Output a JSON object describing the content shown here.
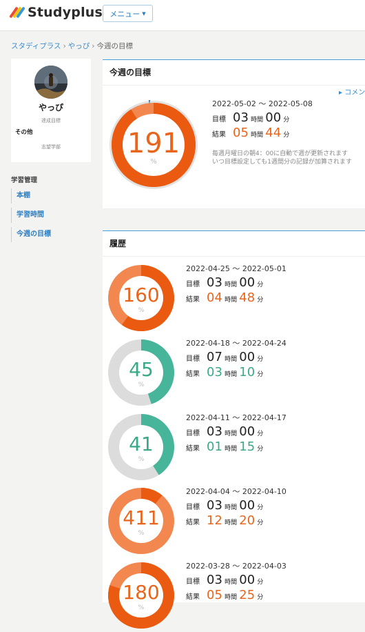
{
  "header": {
    "brand": "Studyplus",
    "menu_label": "メニュー"
  },
  "breadcrumb": {
    "items": [
      "スタディプラス",
      "やっぴ"
    ],
    "current": "今週の目標"
  },
  "profile": {
    "name": "やっぴ",
    "goal_label": "達成目標",
    "other_label": "その他",
    "aspiration_label": "志望学部"
  },
  "nav": {
    "title": "学習管理",
    "items": [
      "本棚",
      "学習時間",
      "今週の目標"
    ]
  },
  "current": {
    "title": "今週の目標",
    "comment_link": "コメン",
    "range": "2022-05-02 ～ 2022-05-08",
    "percent": "191",
    "goal_label": "目標",
    "goal_h": "03",
    "goal_m": "00",
    "result_label": "結果",
    "result_h": "05",
    "result_m": "44",
    "note1": "毎週月曜日の朝4：00に自動で週が更新されます",
    "note2": "いつ目標設定しても1週間分の記録が加算されます",
    "ratio": 1.91
  },
  "units": {
    "hours": "時間",
    "minutes": "分",
    "percent_sign": "%"
  },
  "colors": {
    "accent": "#3a8cd0",
    "orange": "#f2874f",
    "orange_dark": "#ea5a10",
    "teal": "#47b59a",
    "gray": "#dcdcdc"
  },
  "history": {
    "title": "履歴",
    "entries": [
      {
        "range": "2022-04-25 ～ 2022-05-01",
        "percent": "160",
        "ratio": 1.6,
        "goal_h": "03",
        "goal_m": "00",
        "result_h": "04",
        "result_m": "48",
        "color": "orange"
      },
      {
        "range": "2022-04-18 ～ 2022-04-24",
        "percent": "45",
        "ratio": 0.45,
        "goal_h": "07",
        "goal_m": "00",
        "result_h": "03",
        "result_m": "10",
        "color": "teal"
      },
      {
        "range": "2022-04-11 ～ 2022-04-17",
        "percent": "41",
        "ratio": 0.41,
        "goal_h": "03",
        "goal_m": "00",
        "result_h": "01",
        "result_m": "15",
        "color": "teal"
      },
      {
        "range": "2022-04-04 ～ 2022-04-10",
        "percent": "411",
        "ratio": 4.11,
        "goal_h": "03",
        "goal_m": "00",
        "result_h": "12",
        "result_m": "20",
        "color": "orange"
      },
      {
        "range": "2022-03-28 ～ 2022-04-03",
        "percent": "180",
        "ratio": 1.8,
        "goal_h": "03",
        "goal_m": "00",
        "result_h": "05",
        "result_m": "25",
        "color": "orange"
      }
    ],
    "goal_label": "目標",
    "result_label": "結果"
  }
}
